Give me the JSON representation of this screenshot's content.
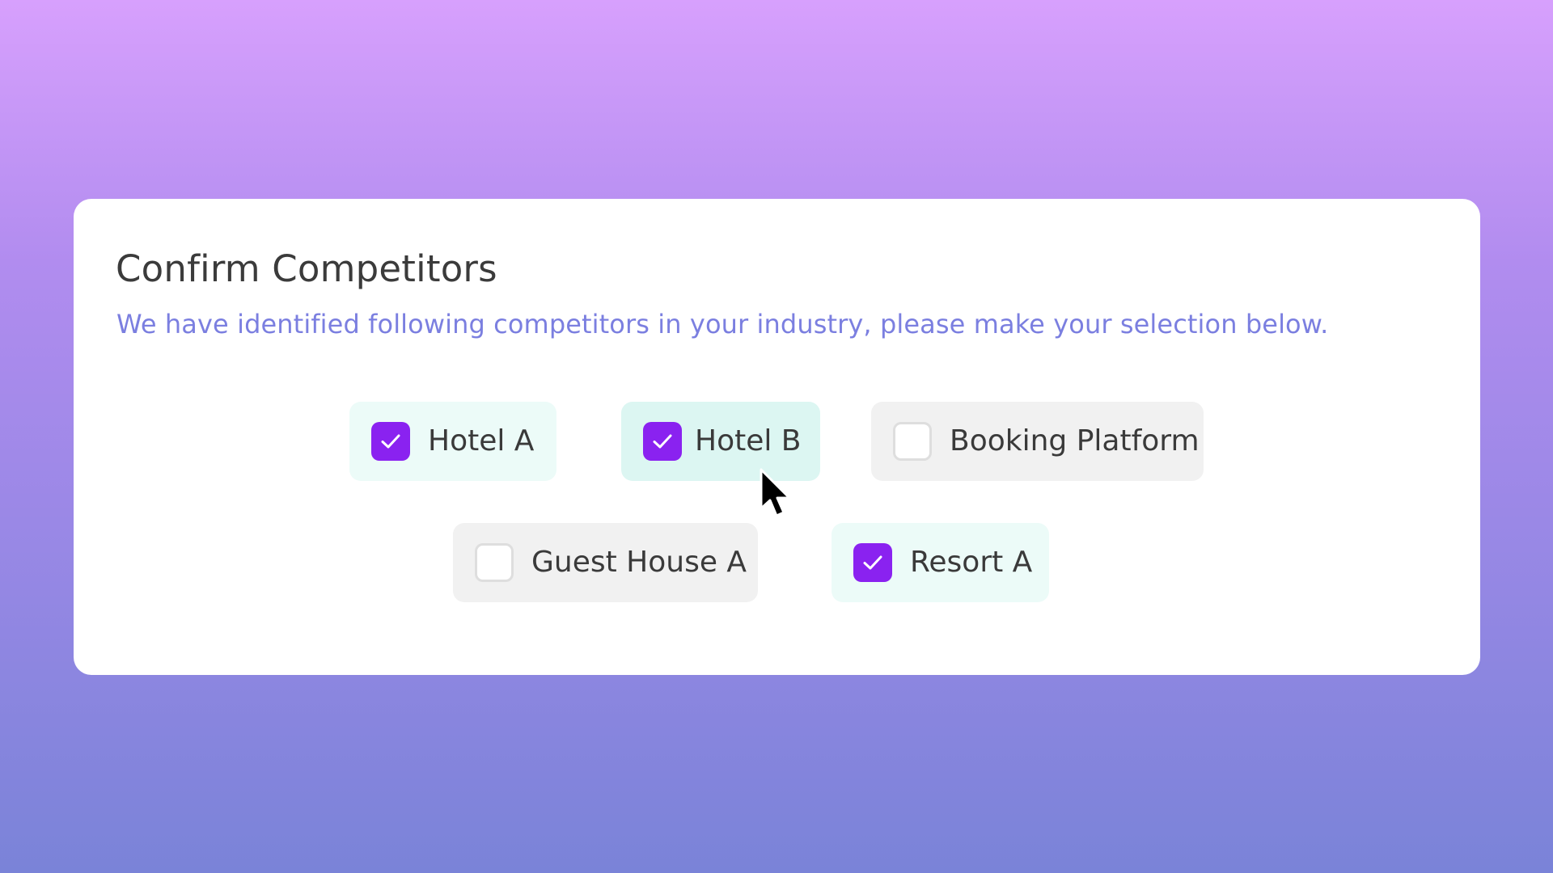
{
  "dialog": {
    "title": "Confirm Competitors",
    "subtitle": "We have identified following competitors in your industry, please make your selection below."
  },
  "options": [
    {
      "label": "Hotel A",
      "checked": true
    },
    {
      "label": "Hotel B",
      "checked": true,
      "hovered": true
    },
    {
      "label": "Booking Platform",
      "checked": false
    },
    {
      "label": "Guest House A",
      "checked": false
    },
    {
      "label": "Resort A",
      "checked": true
    }
  ],
  "colors": {
    "checkbox_checked": "#8a22f0",
    "chip_selected_bg": "#ecfbf8",
    "chip_unselected_bg": "#f1f1f1",
    "subtitle": "#7b7fe0",
    "title": "#3b3b3b"
  },
  "icons": {
    "checkmark": "check-icon",
    "pointer": "mouse-cursor-icon"
  }
}
